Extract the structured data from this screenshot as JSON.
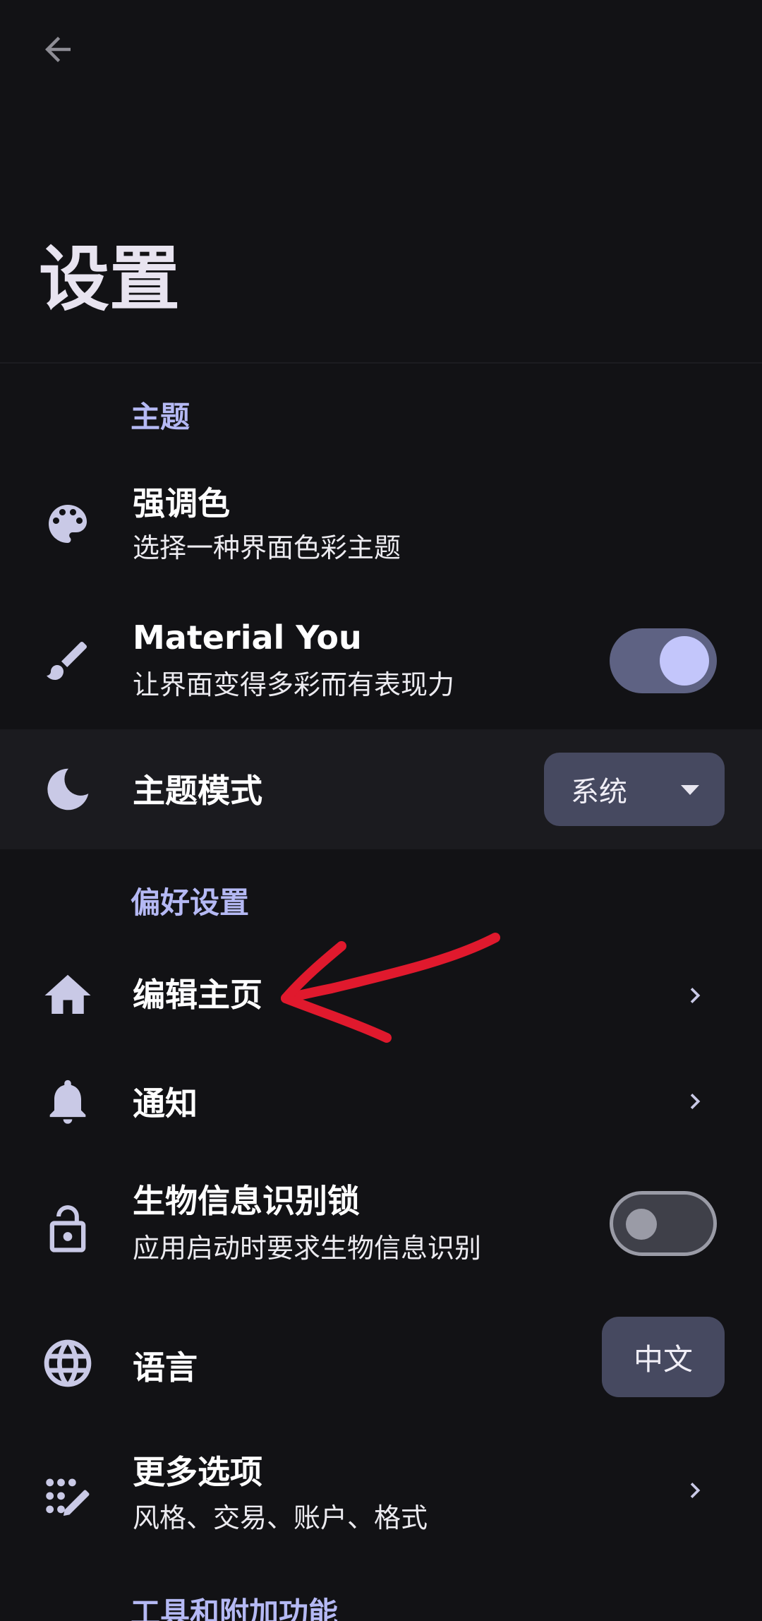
{
  "header": {
    "title": "设置"
  },
  "sections": {
    "theme": "主题",
    "preferences": "偏好设置",
    "tools": "工具和附加功能"
  },
  "items": {
    "accent": {
      "title": "强调色",
      "subtitle": "选择一种界面色彩主题",
      "icon": "palette-icon"
    },
    "material_you": {
      "title": "Material You",
      "subtitle": "让界面变得多彩而有表现力",
      "icon": "brush-icon",
      "toggle_on": true
    },
    "theme_mode": {
      "title": "主题模式",
      "value": "系统",
      "icon": "moon-icon"
    },
    "edit_home": {
      "title": "编辑主页",
      "icon": "home-icon"
    },
    "notifications": {
      "title": "通知",
      "icon": "bell-icon"
    },
    "biometric": {
      "title": "生物信息识别锁",
      "subtitle": "应用启动时要求生物信息识别",
      "icon": "lock-icon",
      "toggle_on": false
    },
    "language": {
      "title": "语言",
      "value": "中文",
      "icon": "globe-icon"
    },
    "more": {
      "title": "更多选项",
      "subtitle": "风格、交易、账户、格式",
      "icon": "magic-wand-icon"
    }
  },
  "colors": {
    "background": "#121215",
    "accent": "#b5b9f4",
    "annotation": "#e0192d"
  }
}
